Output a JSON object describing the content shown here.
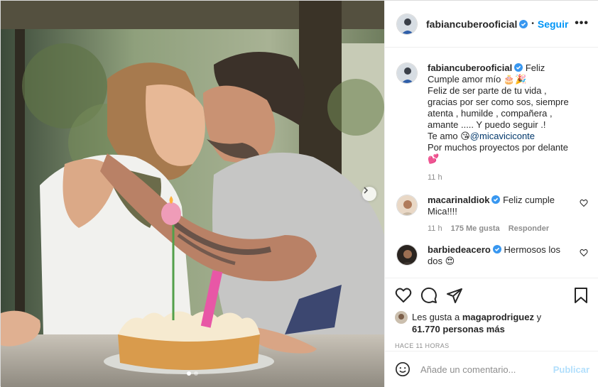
{
  "post": {
    "author": "fabiancuberooficial",
    "follow_label": "Seguir",
    "separator": "•",
    "more_label": "•••"
  },
  "caption": {
    "author": "fabiancuberooficial",
    "line1": "Feliz Cumple amor mío 🎂🎉",
    "line2": "Feliz de ser parte de tu vida ,",
    "line3": "gracias por ser como sos, siempre atenta , humilde , compañera , amante ..... Y puedo seguir .!",
    "line4_prefix": "Te amo 😘",
    "mention": "@micaviciconte",
    "line5": "Por muchos proyectos por delante 💕",
    "time": "11 h"
  },
  "comments": [
    {
      "user": "macarinaldiok",
      "text": "Feliz cumple Mica!!!!",
      "time": "11 h",
      "likes": "175 Me gusta",
      "reply": "Responder"
    },
    {
      "user": "barbiedeacero",
      "text": "Hermosos los dos 😍"
    }
  ],
  "likes": {
    "prefix": "Les gusta a",
    "user": "magaprodriguez",
    "connector": "y",
    "count": "61.770 personas más"
  },
  "timestamp": "HACE 11 HORAS",
  "add_comment": {
    "placeholder": "Añade un comentario...",
    "publish_label": "Publicar"
  },
  "colors": {
    "accent": "#0095f6",
    "publish_disabled": "#b2dffc",
    "muted": "#8e8e8e",
    "mention": "#00376b"
  }
}
